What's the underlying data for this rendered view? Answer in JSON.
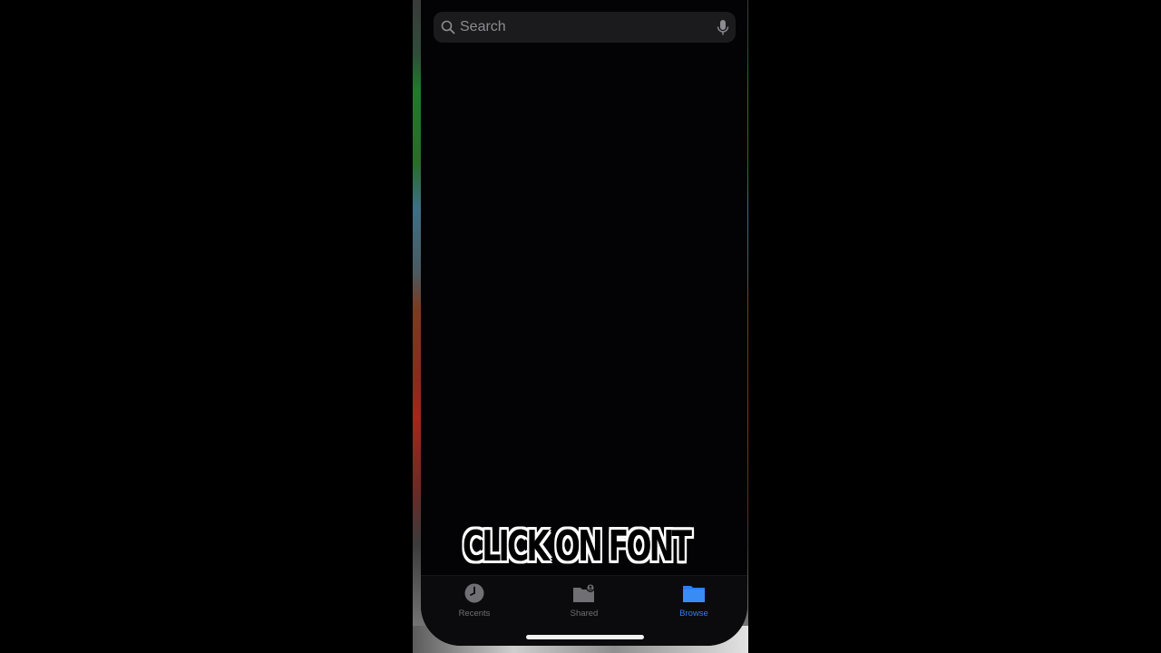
{
  "search": {
    "placeholder": "Search"
  },
  "caption": {
    "text": "CLICK ON FONT"
  },
  "tabs": [
    {
      "label": "Recents",
      "icon": "clock-icon",
      "active": false
    },
    {
      "label": "Shared",
      "icon": "shared-folder-icon",
      "active": false
    },
    {
      "label": "Browse",
      "icon": "folder-icon",
      "active": true
    }
  ],
  "colors": {
    "accent": "#2d7ff0",
    "background": "#030305",
    "inactive": "#6f6f74"
  }
}
